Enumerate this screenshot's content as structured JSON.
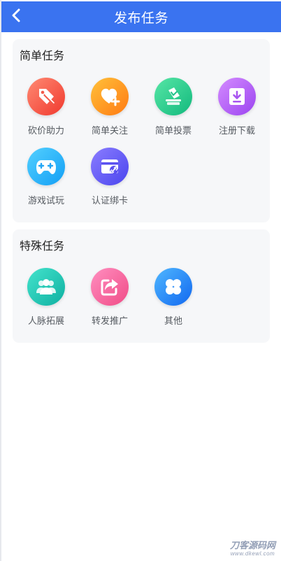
{
  "header": {
    "title": "发布任务",
    "color": "#3a73f0"
  },
  "simple": {
    "title": "简单任务",
    "items": [
      {
        "label": "砍价助力",
        "icon": "tag-slash-icon",
        "colors": [
          "#ff8a73",
          "#f0392e"
        ]
      },
      {
        "label": "简单关注",
        "icon": "heart-plus-icon",
        "colors": [
          "#ffc13a",
          "#ff7a12"
        ]
      },
      {
        "label": "简单投票",
        "icon": "ballot-box-icon",
        "colors": [
          "#57e6a6",
          "#12b97d"
        ]
      },
      {
        "label": "注册下载",
        "icon": "download-box-icon",
        "colors": [
          "#d48bff",
          "#9b44f0"
        ]
      },
      {
        "label": "游戏试玩",
        "icon": "gamepad-icon",
        "colors": [
          "#53d0ff",
          "#139ff5"
        ]
      },
      {
        "label": "认证绑卡",
        "icon": "card-link-icon",
        "colors": [
          "#8b7dff",
          "#4a45ee"
        ]
      }
    ]
  },
  "special": {
    "title": "特殊任务",
    "items": [
      {
        "label": "人脉拓展",
        "icon": "people-icon",
        "colors": [
          "#43e3cc",
          "#0fb0a1"
        ]
      },
      {
        "label": "转发推广",
        "icon": "share-icon",
        "colors": [
          "#ff8fc0",
          "#f04b86"
        ]
      },
      {
        "label": "其他",
        "icon": "clover-icon",
        "colors": [
          "#4fb7ff",
          "#1268f0"
        ]
      }
    ]
  },
  "watermark": {
    "text": "刀客源码网",
    "sub": "www.dkewl.com"
  }
}
